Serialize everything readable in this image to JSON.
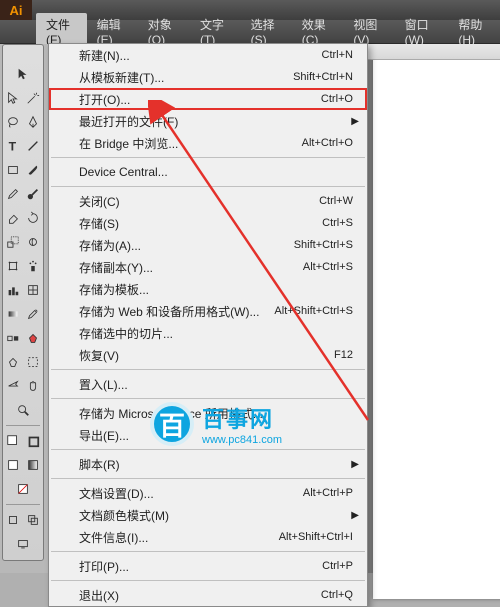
{
  "app": {
    "icon_text": "Ai"
  },
  "menubar": {
    "items": [
      {
        "label": "文件(F)",
        "active": true
      },
      {
        "label": "编辑(E)"
      },
      {
        "label": "对象(O)"
      },
      {
        "label": "文字(T)"
      },
      {
        "label": "选择(S)"
      },
      {
        "label": "效果(C)"
      },
      {
        "label": "视图(V)"
      },
      {
        "label": "窗口(W)"
      },
      {
        "label": "帮助(H)"
      }
    ]
  },
  "file_menu": {
    "groups": [
      [
        {
          "label": "新建(N)...",
          "shortcut": "Ctrl+N"
        },
        {
          "label": "从模板新建(T)...",
          "shortcut": "Shift+Ctrl+N"
        },
        {
          "label": "打开(O)...",
          "shortcut": "Ctrl+O",
          "highlight": true
        },
        {
          "label": "最近打开的文件(F)",
          "submenu": true
        },
        {
          "label": "在 Bridge 中浏览...",
          "shortcut": "Alt+Ctrl+O"
        }
      ],
      [
        {
          "label": "Device Central..."
        }
      ],
      [
        {
          "label": "关闭(C)",
          "shortcut": "Ctrl+W"
        },
        {
          "label": "存储(S)",
          "shortcut": "Ctrl+S"
        },
        {
          "label": "存储为(A)...",
          "shortcut": "Shift+Ctrl+S"
        },
        {
          "label": "存储副本(Y)...",
          "shortcut": "Alt+Ctrl+S"
        },
        {
          "label": "存储为模板..."
        },
        {
          "label": "存储为 Web 和设备所用格式(W)...",
          "shortcut": "Alt+Shift+Ctrl+S"
        },
        {
          "label": "存储选中的切片..."
        },
        {
          "label": "恢复(V)",
          "shortcut": "F12"
        }
      ],
      [
        {
          "label": "置入(L)..."
        }
      ],
      [
        {
          "label": "存储为 Microsoft Office 所用格式..."
        },
        {
          "label": "导出(E)..."
        }
      ],
      [
        {
          "label": "脚本(R)",
          "submenu": true
        }
      ],
      [
        {
          "label": "文档设置(D)...",
          "shortcut": "Alt+Ctrl+P"
        },
        {
          "label": "文档颜色模式(M)",
          "submenu": true
        },
        {
          "label": "文件信息(I)...",
          "shortcut": "Alt+Shift+Ctrl+I"
        }
      ],
      [
        {
          "label": "打印(P)...",
          "shortcut": "Ctrl+P"
        }
      ],
      [
        {
          "label": "退出(X)",
          "shortcut": "Ctrl+Q"
        }
      ]
    ]
  },
  "watermark": {
    "badge": "百",
    "title": "百事网",
    "url": "www.pc841.com"
  }
}
